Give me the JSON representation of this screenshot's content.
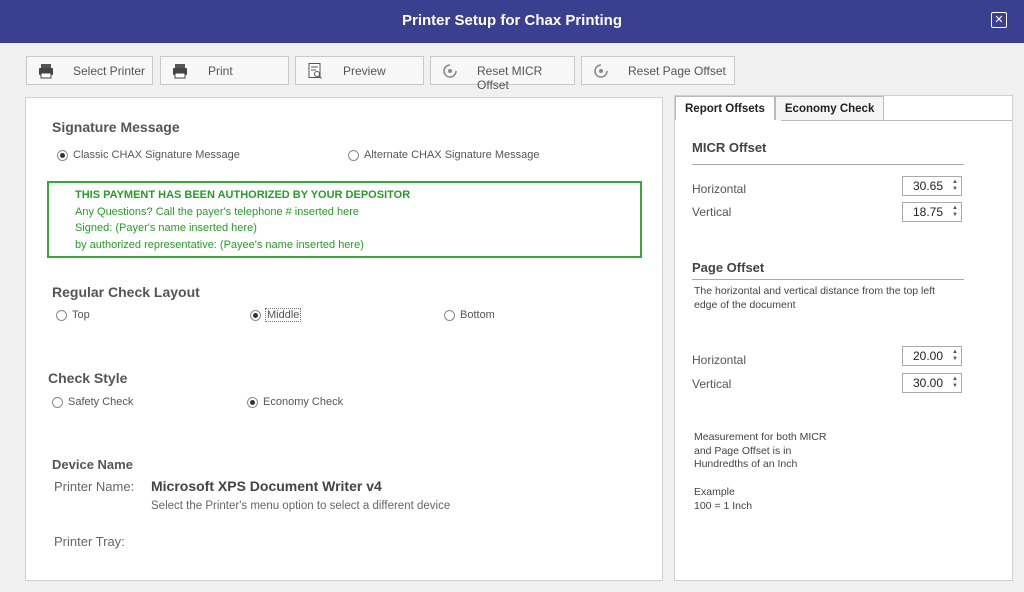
{
  "window": {
    "title": "Printer Setup for Chax Printing",
    "close_icon": "close-icon"
  },
  "toolbar": {
    "select_printer": "Select Printer",
    "print": "Print",
    "preview": "Preview",
    "reset_micr": "Reset MICR Offset",
    "reset_page": "Reset Page Offset"
  },
  "signature": {
    "heading": "Signature Message",
    "option_classic": "Classic CHAX Signature Message",
    "option_alternate": "Alternate CHAX Signature Message",
    "selected": "classic",
    "box": {
      "line1": "THIS PAYMENT HAS BEEN AUTHORIZED BY YOUR DEPOSITOR",
      "line2": "Any Questions? Call the payer's telephone # inserted here",
      "line3": "Signed: (Payer's name inserted here)",
      "line4": "by authorized representative: (Payee's name inserted here)",
      "border_color": "#3aa53a"
    }
  },
  "layout": {
    "heading": "Regular Check Layout",
    "options": [
      "Top",
      "Middle",
      "Bottom"
    ],
    "selected": "Middle"
  },
  "style": {
    "heading": "Check Style",
    "options": [
      "Safety Check",
      "Economy Check"
    ],
    "selected": "Economy Check"
  },
  "device": {
    "heading": "Device Name",
    "printer_label": "Printer Name:",
    "printer_value": "Microsoft XPS Document Writer v4",
    "hint": "Select the Printer's menu option to select a different device",
    "tray_label": "Printer Tray:"
  },
  "side": {
    "tabs": [
      "Report Offsets",
      "Economy Check"
    ],
    "active_tab": "Report Offsets",
    "micr": {
      "heading": "MICR Offset",
      "horizontal_label": "Horizontal",
      "horizontal_value": "30.65",
      "vertical_label": "Vertical",
      "vertical_value": "18.75"
    },
    "page": {
      "heading": "Page Offset",
      "desc1": "The horizontal and vertical distance from the top left",
      "desc2": "edge of the document",
      "horizontal_label": "Horizontal",
      "horizontal_value": "20.00",
      "vertical_label": "Vertical",
      "vertical_value": "30.00"
    },
    "note1": "Measurement for both MICR",
    "note2": "and Page Offset is in",
    "note3": "Hundredths of an Inch",
    "example1": "Example",
    "example2": "100 = 1 Inch"
  },
  "colors": {
    "titlebar": "#3a3f8f",
    "signature_green": "#2a9a2a"
  }
}
